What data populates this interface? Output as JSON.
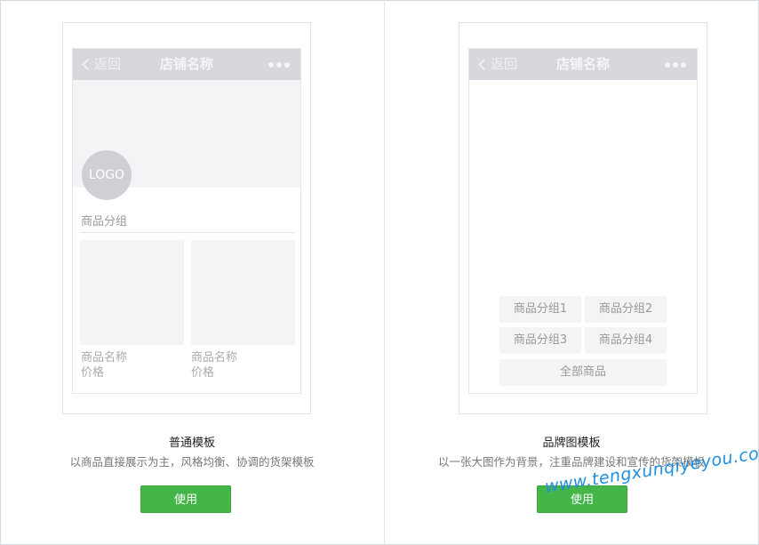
{
  "templates": [
    {
      "phone": {
        "back_label": "返回",
        "store_name": "店铺名称",
        "logo": "LOGO",
        "group_label": "商品分组",
        "products": [
          {
            "name": "商品名称",
            "price": "价格"
          },
          {
            "name": "商品名称",
            "price": "价格"
          }
        ]
      },
      "title": "普通模板",
      "description": "以商品直接展示为主，风格均衡、协调的货架模板",
      "button_label": "使用"
    },
    {
      "phone": {
        "back_label": "返回",
        "store_name": "店铺名称",
        "categories": [
          "商品分组1",
          "商品分组2",
          "商品分组3",
          "商品分组4"
        ],
        "all_label": "全部商品"
      },
      "title": "品牌图模板",
      "description": "以一张大图作为背景，注重品牌建设和宣传的货架模板",
      "button_label": "使用"
    }
  ],
  "watermark": "www.tengxunqiyeyou.com",
  "colors": {
    "accent": "#44b549",
    "navbar": "#d7d8dd",
    "placeholder": "#f3f4f6",
    "watermark": "#1e8fe0"
  }
}
